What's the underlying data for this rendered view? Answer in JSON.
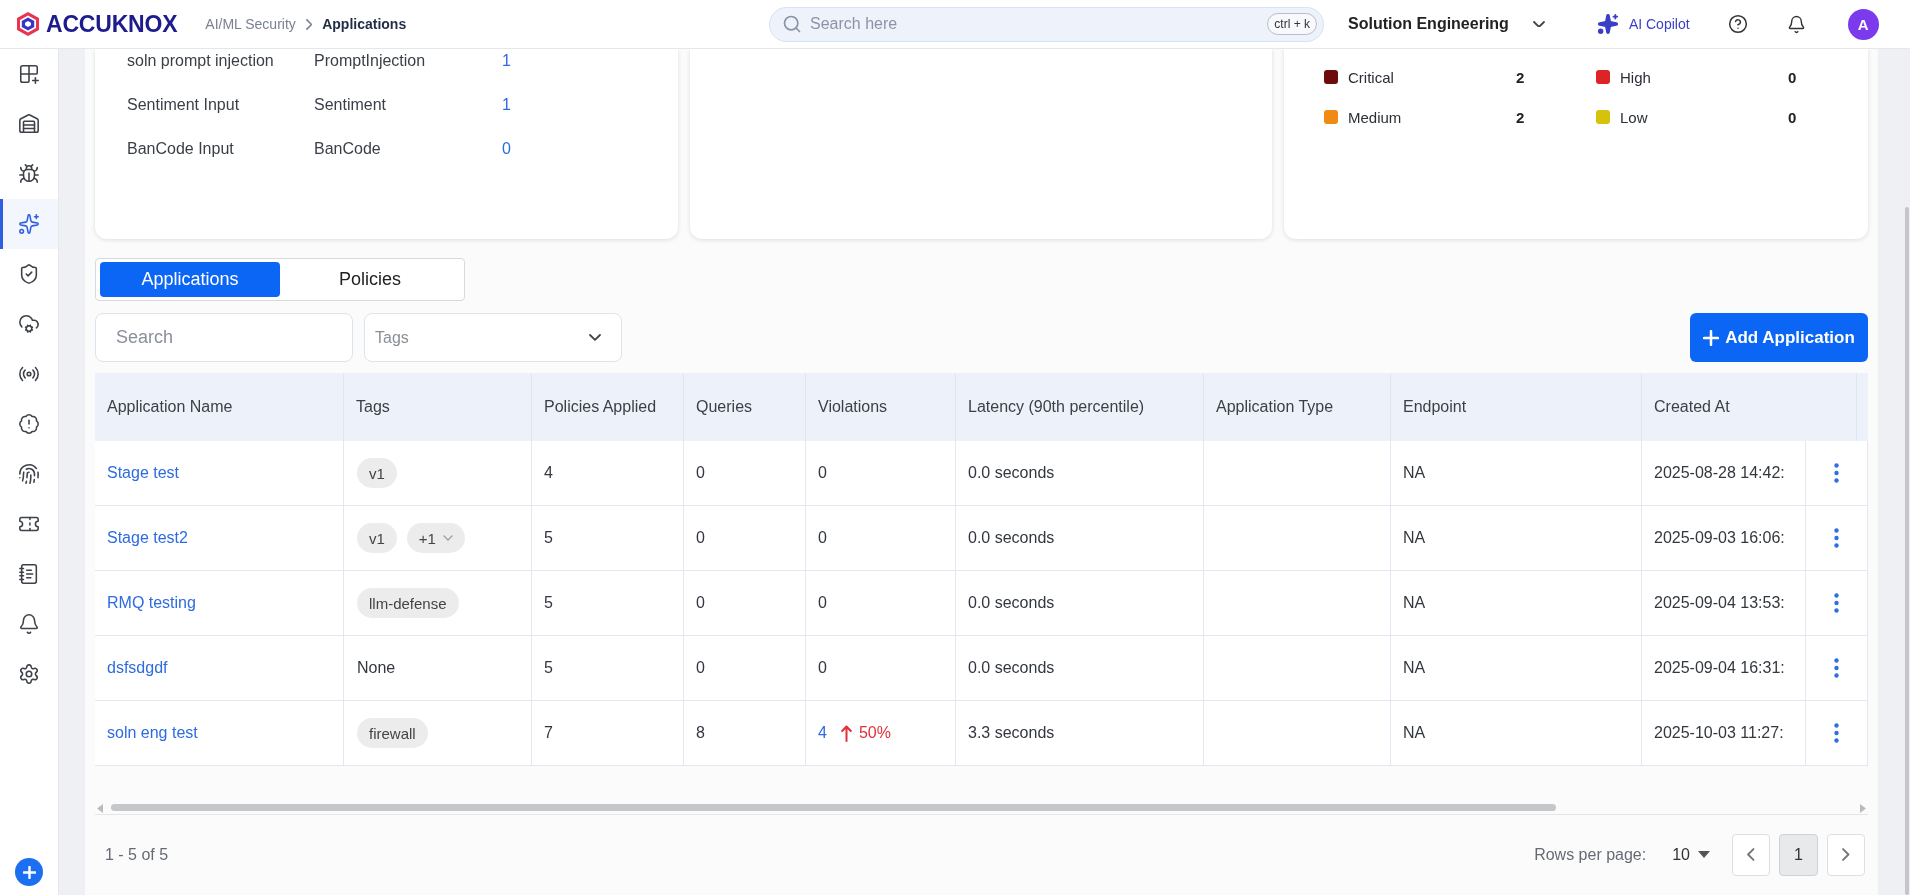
{
  "header": {
    "logo_text": "ACCUKNOX",
    "breadcrumb": [
      {
        "label": "AI/ML Security",
        "current": false
      },
      {
        "label": "Applications",
        "current": true
      }
    ],
    "search": {
      "placeholder": "Search here",
      "shortcut": "ctrl + k"
    },
    "workspace": "Solution Engineering",
    "copilot_label": "AI Copilot",
    "avatar_initial": "A"
  },
  "sidebar": {
    "items": [
      {
        "selected": false
      },
      {
        "selected": false
      },
      {
        "selected": false
      },
      {
        "selected": true
      },
      {
        "selected": false
      },
      {
        "selected": false
      },
      {
        "selected": false
      },
      {
        "selected": false
      },
      {
        "selected": false
      },
      {
        "selected": false
      },
      {
        "selected": false
      },
      {
        "selected": false
      },
      {
        "selected": false
      }
    ]
  },
  "cards": [
    {
      "kind": "policy-list",
      "rows": [
        {
          "name": "soln prompt injection",
          "type": "PromptInjection",
          "count": "1"
        },
        {
          "name": "Sentiment Input",
          "type": "Sentiment",
          "count": "1"
        },
        {
          "name": "BanCode Input",
          "type": "BanCode",
          "count": "0"
        }
      ]
    },
    {
      "kind": "empty"
    },
    {
      "kind": "severity",
      "legend": [
        {
          "label": "Critical",
          "count": "2",
          "color": "#6e0b0b"
        },
        {
          "label": "High",
          "count": "0",
          "color": "#dc2328"
        },
        {
          "label": "Medium",
          "count": "2",
          "color": "#f08a12"
        },
        {
          "label": "Low",
          "count": "0",
          "color": "#d6c20c"
        }
      ]
    }
  ],
  "view_tabs": [
    {
      "label": "Applications",
      "selected": true
    },
    {
      "label": "Policies",
      "selected": false
    }
  ],
  "filters": {
    "search_placeholder": "Search",
    "tags_placeholder": "Tags"
  },
  "add_button": {
    "label": "Add Application"
  },
  "table": {
    "columns": [
      "Application Name",
      "Tags",
      "Policies Applied",
      "Queries",
      "Violations",
      "Latency (90th percentile)",
      "Application Type",
      "Endpoint",
      "Created At"
    ],
    "rows": [
      {
        "name": "Stage test",
        "tags": [
          {
            "kind": "chip",
            "label": "v1"
          }
        ],
        "policies_applied": "4",
        "queries": "0",
        "violations": {
          "count": "0",
          "link": false
        },
        "latency": "0.0 seconds",
        "endpoint": "NA",
        "created_at": "2025-08-28 14:42:"
      },
      {
        "name": "Stage test2",
        "tags": [
          {
            "kind": "chip",
            "label": "v1"
          },
          {
            "kind": "more",
            "label": "+1"
          }
        ],
        "policies_applied": "5",
        "queries": "0",
        "violations": {
          "count": "0",
          "link": false
        },
        "latency": "0.0 seconds",
        "endpoint": "NA",
        "created_at": "2025-09-03 16:06:"
      },
      {
        "name": "RMQ testing",
        "tags": [
          {
            "kind": "chip",
            "label": "llm-defense"
          }
        ],
        "policies_applied": "5",
        "queries": "0",
        "violations": {
          "count": "0",
          "link": false
        },
        "latency": "0.0 seconds",
        "endpoint": "NA",
        "created_at": "2025-09-04 13:53:"
      },
      {
        "name": "dsfsdgdf",
        "tags": [
          {
            "kind": "text",
            "label": "None"
          }
        ],
        "policies_applied": "5",
        "queries": "0",
        "violations": {
          "count": "0",
          "link": false
        },
        "latency": "0.0 seconds",
        "endpoint": "NA",
        "created_at": "2025-09-04 16:31:"
      },
      {
        "name": "soln eng test",
        "tags": [
          {
            "kind": "chip",
            "label": "firewall"
          }
        ],
        "policies_applied": "7",
        "queries": "8",
        "violations": {
          "count": "4",
          "link": true,
          "change": "50%",
          "rising": true
        },
        "latency": "3.3 seconds",
        "endpoint": "NA",
        "created_at": "2025-10-03 11:27:"
      }
    ]
  },
  "pagination": {
    "range": "1 - 5 of 5",
    "rows_per_page_label": "Rows per page:",
    "rows_per_page": "10",
    "pages": [
      {
        "label": "1",
        "selected": true
      }
    ]
  }
}
